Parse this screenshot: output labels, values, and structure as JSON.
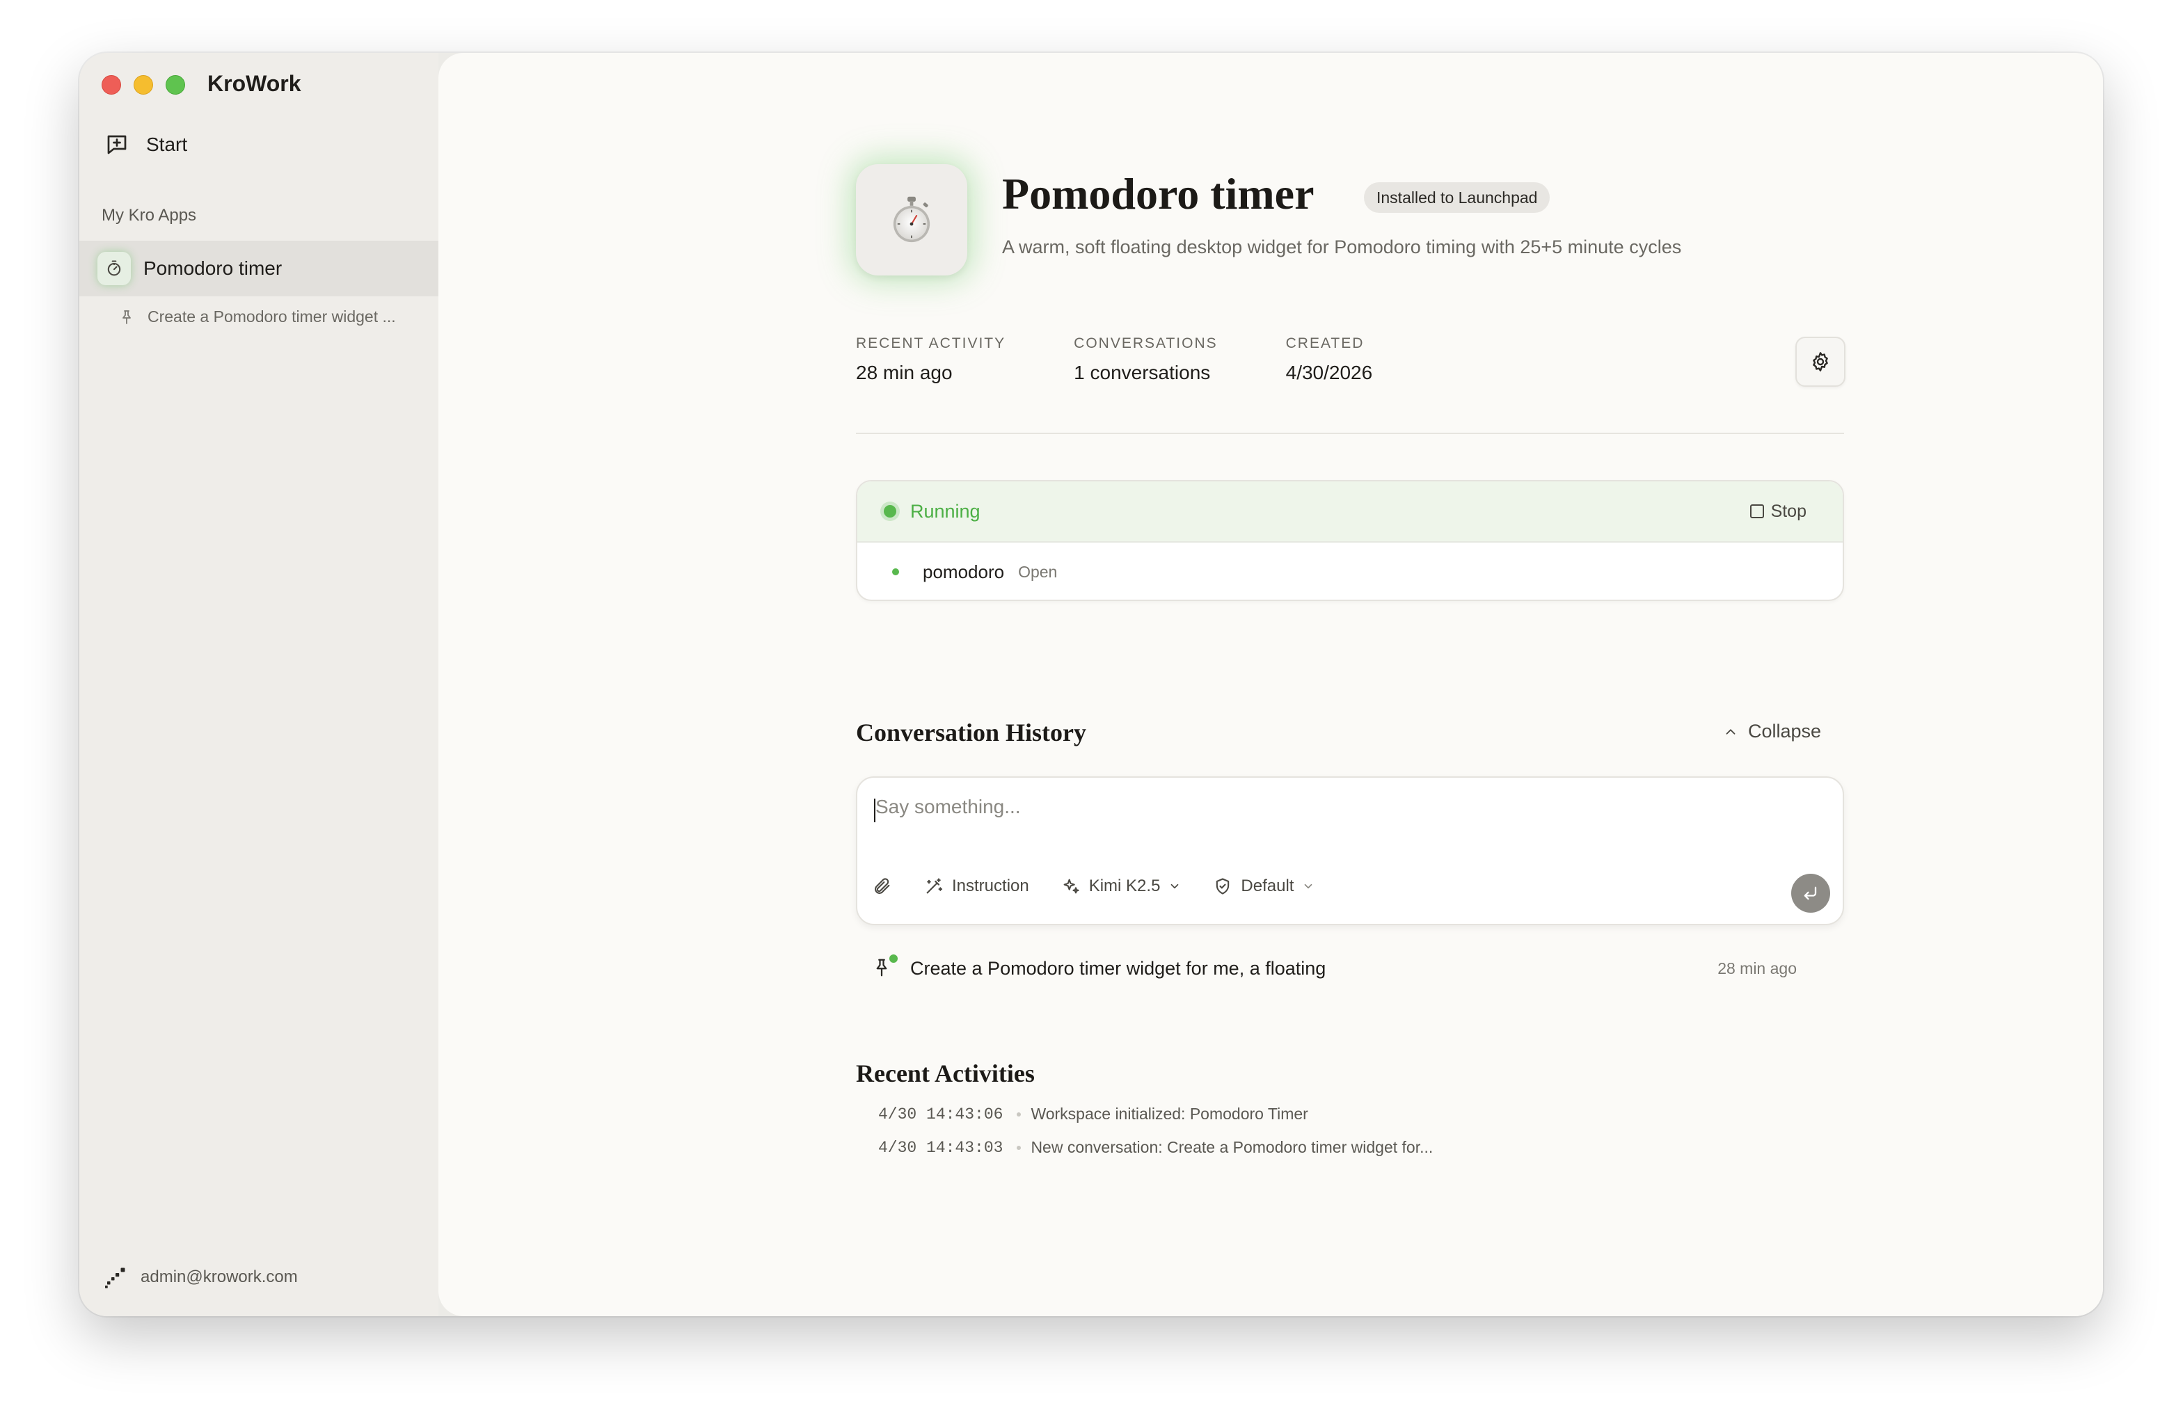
{
  "app": {
    "title": "KroWork"
  },
  "sidebar": {
    "start_label": "Start",
    "section_label": "My Kro Apps",
    "apps": [
      {
        "label": "Pomodoro timer"
      }
    ],
    "conversations": [
      {
        "label": "Create a Pomodoro timer widget ..."
      }
    ],
    "user_email": "admin@krowork.com"
  },
  "header": {
    "app_name": "Pomodoro timer",
    "badge": "Installed to Launchpad",
    "description": "A warm, soft floating desktop widget for Pomodoro timing with 25+5 minute cycles"
  },
  "stats": [
    {
      "label": "RECENT ACTIVITY",
      "value": "28 min ago"
    },
    {
      "label": "CONVERSATIONS",
      "value": "1 conversations"
    },
    {
      "label": "CREATED",
      "value": "4/30/2026"
    }
  ],
  "status": {
    "state": "Running",
    "stop_label": "Stop",
    "process_name": "pomodoro",
    "open_label": "Open"
  },
  "conversation_history": {
    "title": "Conversation History",
    "collapse_label": "Collapse",
    "composer_placeholder": "Say something...",
    "toolbar": {
      "instruction_label": "Instruction",
      "model_label": "Kimi K2.5",
      "mode_label": "Default"
    },
    "items": [
      {
        "text": "Create a Pomodoro timer widget for me, a floating",
        "time": "28 min ago"
      }
    ]
  },
  "recent_activities": {
    "title": "Recent Activities",
    "items": [
      {
        "time": "4/30 14:43:06",
        "text": "Workspace initialized: Pomodoro Timer"
      },
      {
        "time": "4/30 14:43:03",
        "text": "New conversation: Create a Pomodoro timer widget for..."
      }
    ]
  },
  "colors": {
    "accent_green": "#58b84d",
    "running_bg": "#eef5ea",
    "sidebar_bg": "#efede9",
    "main_bg": "#fbfaf7"
  },
  "icons": {
    "app": "stopwatch-icon",
    "start": "new-chat-icon",
    "conversation": "pin-icon",
    "settings": "gear-icon",
    "attach": "paperclip-icon",
    "instruction": "magic-wand-icon",
    "model": "sparkles-icon",
    "mode": "shield-icon",
    "send": "enter-icon"
  }
}
